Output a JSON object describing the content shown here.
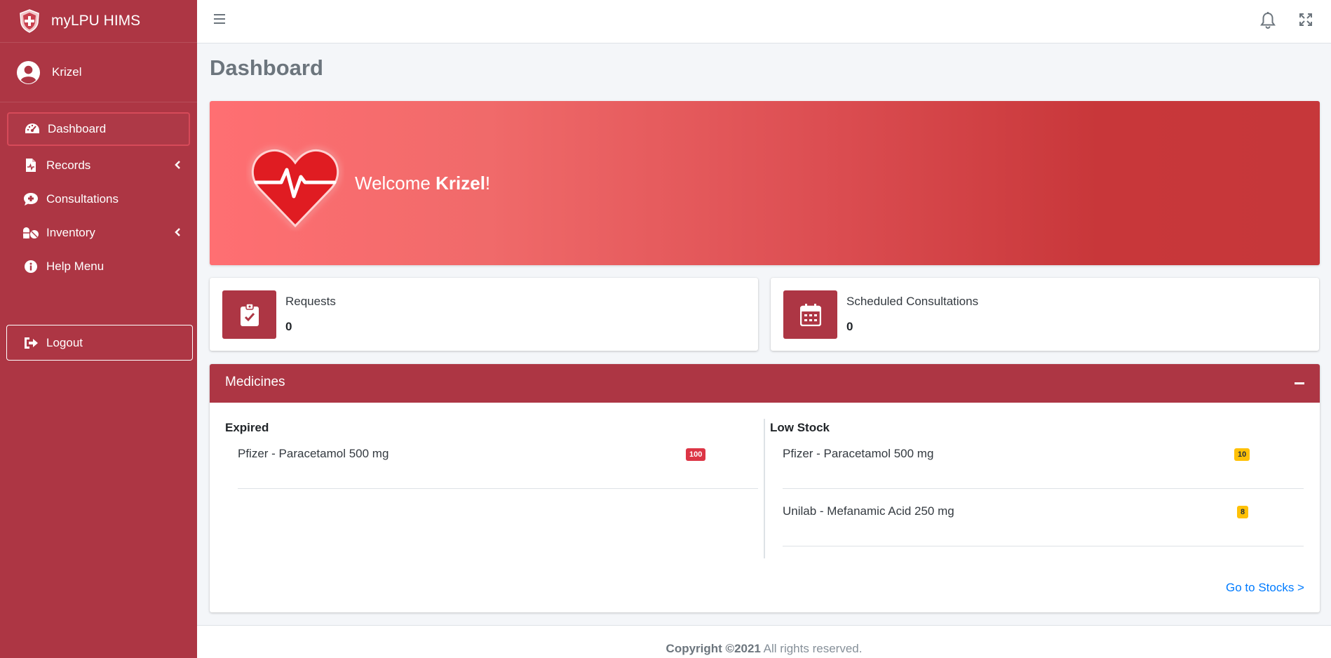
{
  "brand": {
    "name": "myLPU HIMS"
  },
  "user": {
    "name": "Krizel"
  },
  "sidebar": {
    "items": [
      {
        "label": "Dashboard",
        "icon": "tachometer-icon",
        "active": true
      },
      {
        "label": "Records",
        "icon": "file-medical-icon",
        "has_submenu": true
      },
      {
        "label": "Consultations",
        "icon": "comment-medical-icon"
      },
      {
        "label": "Inventory",
        "icon": "capsules-icon",
        "has_submenu": true
      },
      {
        "label": "Help Menu",
        "icon": "info-circle-icon"
      }
    ],
    "logout_label": "Logout"
  },
  "page": {
    "title": "Dashboard"
  },
  "welcome": {
    "prefix": "Welcome ",
    "name": "Krizel",
    "suffix": "!"
  },
  "stats": [
    {
      "label": "Requests",
      "value": "0",
      "icon": "clipboard-check-icon"
    },
    {
      "label": "Scheduled Consultations",
      "value": "0",
      "icon": "calendar-icon"
    }
  ],
  "medicines": {
    "title": "Medicines",
    "expired": {
      "title": "Expired",
      "items": [
        {
          "name": "Pfizer - Paracetamol 500 mg",
          "count": "100"
        }
      ]
    },
    "low_stock": {
      "title": "Low Stock",
      "items": [
        {
          "name": "Pfizer - Paracetamol 500 mg",
          "count": "10"
        },
        {
          "name": "Unilab - Mefanamic Acid 250 mg",
          "count": "8"
        }
      ]
    },
    "link_label": "Go to Stocks >"
  },
  "footer": {
    "copyright": "Copyright ©2021",
    "rights": " All rights reserved."
  },
  "colors": {
    "primary": "#ad3644",
    "danger": "#dc3545",
    "warning": "#ffc107",
    "link": "#007bff"
  }
}
